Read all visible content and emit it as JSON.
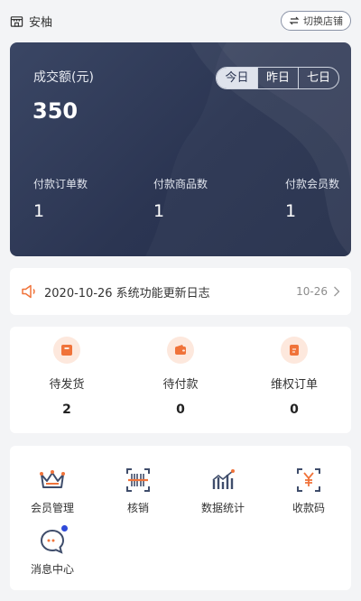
{
  "header": {
    "store_name": "安柚",
    "switch_label": "切换店铺"
  },
  "stats": {
    "amount_label": "成交额(元)",
    "amount_value": "350",
    "periods": [
      "今日",
      "昨日",
      "七日"
    ],
    "active_period": "今日",
    "metrics": [
      {
        "label": "付款订单数",
        "value": "1"
      },
      {
        "label": "付款商品数",
        "value": "1"
      },
      {
        "label": "付款会员数",
        "value": "1"
      }
    ]
  },
  "notice": {
    "text": "2020-10-26 系统功能更新日志",
    "date": "10-26"
  },
  "orders": [
    {
      "label": "待发货",
      "count": "2",
      "icon": "package-icon"
    },
    {
      "label": "待付款",
      "count": "0",
      "icon": "wallet-icon"
    },
    {
      "label": "维权订单",
      "count": "0",
      "icon": "refund-icon"
    }
  ],
  "tools": [
    {
      "label": "会员管理",
      "icon": "crown-icon"
    },
    {
      "label": "核销",
      "icon": "barcode-scan-icon"
    },
    {
      "label": "数据统计",
      "icon": "bar-chart-icon"
    },
    {
      "label": "收款码",
      "icon": "yuan-scan-icon"
    },
    {
      "label": "消息中心",
      "icon": "message-icon",
      "has_badge": true
    }
  ],
  "colors": {
    "card_bg": "#2b3552",
    "accent_orange": "#f0733a",
    "icon_navy": "#3f4d6b",
    "badge_blue": "#2f4ad9"
  }
}
